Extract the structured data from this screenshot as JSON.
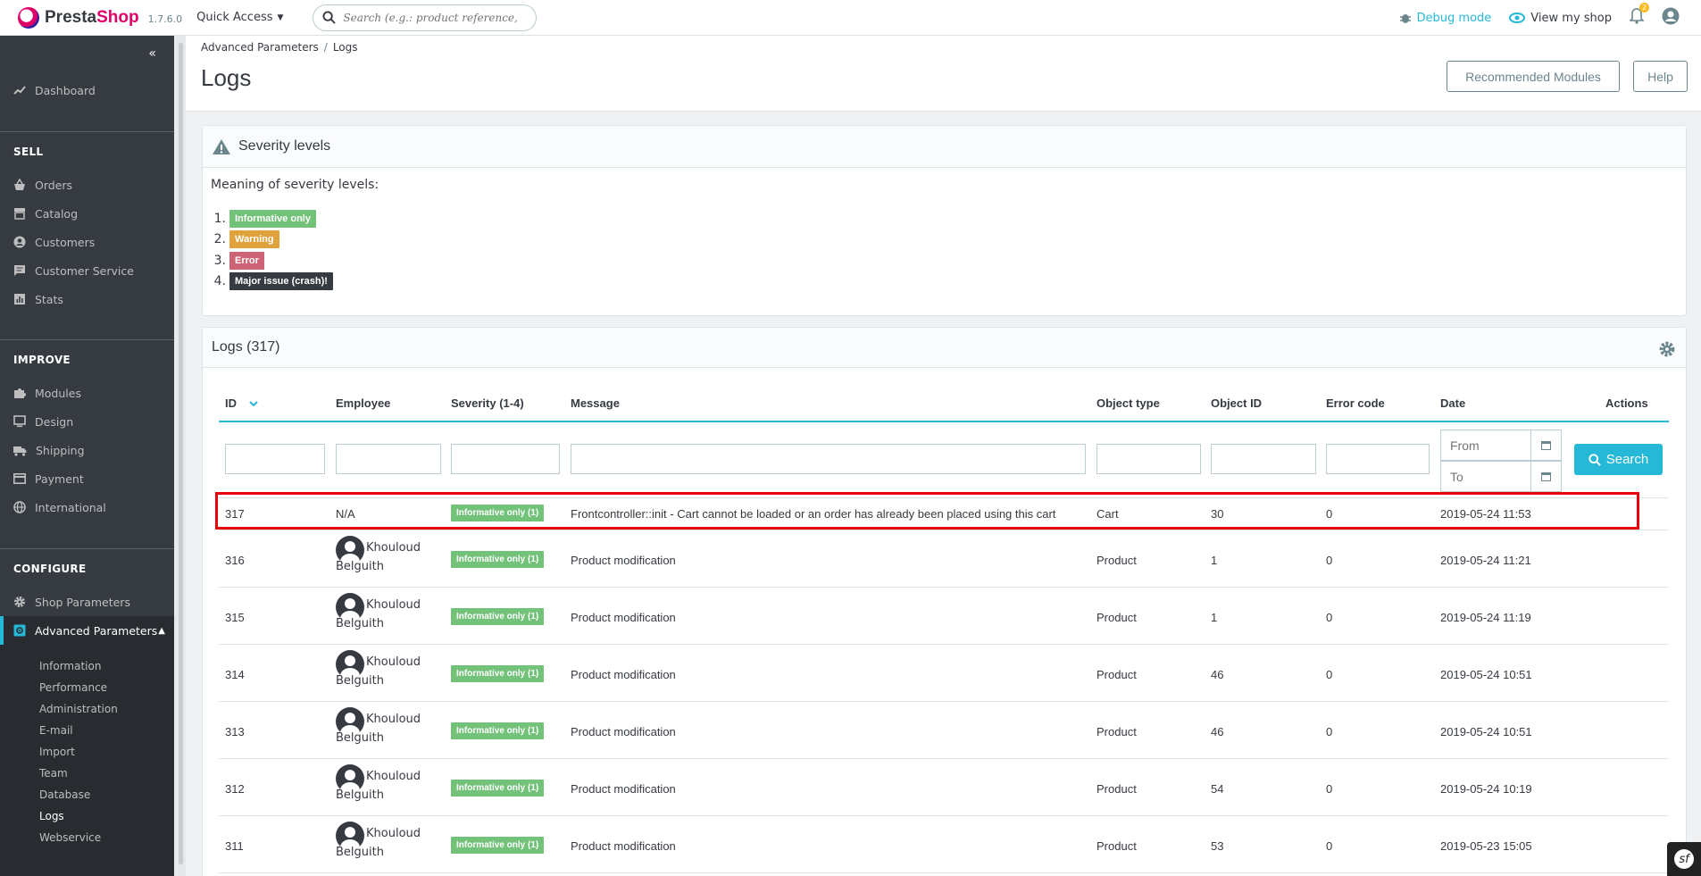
{
  "header": {
    "brand_pre": "Presta",
    "brand_post": "Shop",
    "version": "1.7.6.0",
    "quick_access": "Quick Access",
    "search_placeholder": "Search (e.g.: product reference, customer name...)",
    "debug_mode": "Debug mode",
    "view_shop": "View my shop",
    "notifications_count": "2"
  },
  "sidebar": {
    "dashboard": "Dashboard",
    "sell_title": "SELL",
    "sell": [
      "Orders",
      "Catalog",
      "Customers",
      "Customer Service",
      "Stats"
    ],
    "improve_title": "IMPROVE",
    "improve": [
      "Modules",
      "Design",
      "Shipping",
      "Payment",
      "International"
    ],
    "configure_title": "CONFIGURE",
    "configure": [
      "Shop Parameters",
      "Advanced Parameters"
    ],
    "advanced_sub": [
      "Information",
      "Performance",
      "Administration",
      "E-mail",
      "Import",
      "Team",
      "Database",
      "Logs",
      "Webservice"
    ],
    "active_sub": "Logs"
  },
  "page": {
    "breadcrumb_parent": "Advanced Parameters",
    "breadcrumb_sep": "/",
    "breadcrumb_current": "Logs",
    "title": "Logs",
    "recommended_modules": "Recommended Modules",
    "help": "Help"
  },
  "severity_panel": {
    "title": "Severity levels",
    "intro": "Meaning of severity levels:",
    "levels": [
      {
        "num": "1.",
        "label": "Informative only",
        "color": "#72c279"
      },
      {
        "num": "2.",
        "label": "Warning",
        "color": "#e0a23b"
      },
      {
        "num": "3.",
        "label": "Error",
        "color": "#cd6475"
      },
      {
        "num": "4.",
        "label": "Major issue (crash)!",
        "color": "#363a41"
      }
    ]
  },
  "logs_panel": {
    "title": "Logs (317)",
    "columns": [
      "ID",
      "Employee",
      "Severity (1-4)",
      "Message",
      "Object type",
      "Object ID",
      "Error code",
      "Date",
      "Actions"
    ],
    "date_from_placeholder": "From",
    "date_to_placeholder": "To",
    "search_button": "Search",
    "rows": [
      {
        "id": "317",
        "employee_first": "N/A",
        "employee_last": "",
        "avatar": false,
        "severity": "Informative only (1)",
        "message": "Frontcontroller::init - Cart cannot be loaded or an order has already been placed using this cart",
        "object_type": "Cart",
        "object_id": "30",
        "error_code": "0",
        "date": "2019-05-24 11:53"
      },
      {
        "id": "316",
        "employee_first": "Khouloud",
        "employee_last": "Belguith",
        "avatar": true,
        "severity": "Informative only (1)",
        "message": "Product modification",
        "object_type": "Product",
        "object_id": "1",
        "error_code": "0",
        "date": "2019-05-24 11:21"
      },
      {
        "id": "315",
        "employee_first": "Khouloud",
        "employee_last": "Belguith",
        "avatar": true,
        "severity": "Informative only (1)",
        "message": "Product modification",
        "object_type": "Product",
        "object_id": "1",
        "error_code": "0",
        "date": "2019-05-24 11:19"
      },
      {
        "id": "314",
        "employee_first": "Khouloud",
        "employee_last": "Belguith",
        "avatar": true,
        "severity": "Informative only (1)",
        "message": "Product modification",
        "object_type": "Product",
        "object_id": "46",
        "error_code": "0",
        "date": "2019-05-24 10:51"
      },
      {
        "id": "313",
        "employee_first": "Khouloud",
        "employee_last": "Belguith",
        "avatar": true,
        "severity": "Informative only (1)",
        "message": "Product modification",
        "object_type": "Product",
        "object_id": "46",
        "error_code": "0",
        "date": "2019-05-24 10:51"
      },
      {
        "id": "312",
        "employee_first": "Khouloud",
        "employee_last": "Belguith",
        "avatar": true,
        "severity": "Informative only (1)",
        "message": "Product modification",
        "object_type": "Product",
        "object_id": "54",
        "error_code": "0",
        "date": "2019-05-24 10:19"
      },
      {
        "id": "311",
        "employee_first": "Khouloud",
        "employee_last": "Belguith",
        "avatar": true,
        "severity": "Informative only (1)",
        "message": "Product modification",
        "object_type": "Product",
        "object_id": "53",
        "error_code": "0",
        "date": "2019-05-23 15:05"
      }
    ]
  },
  "colors": {
    "accent": "#25b9d7",
    "sidebar_bg": "#363a41",
    "highlight_border": "#e8000b"
  }
}
